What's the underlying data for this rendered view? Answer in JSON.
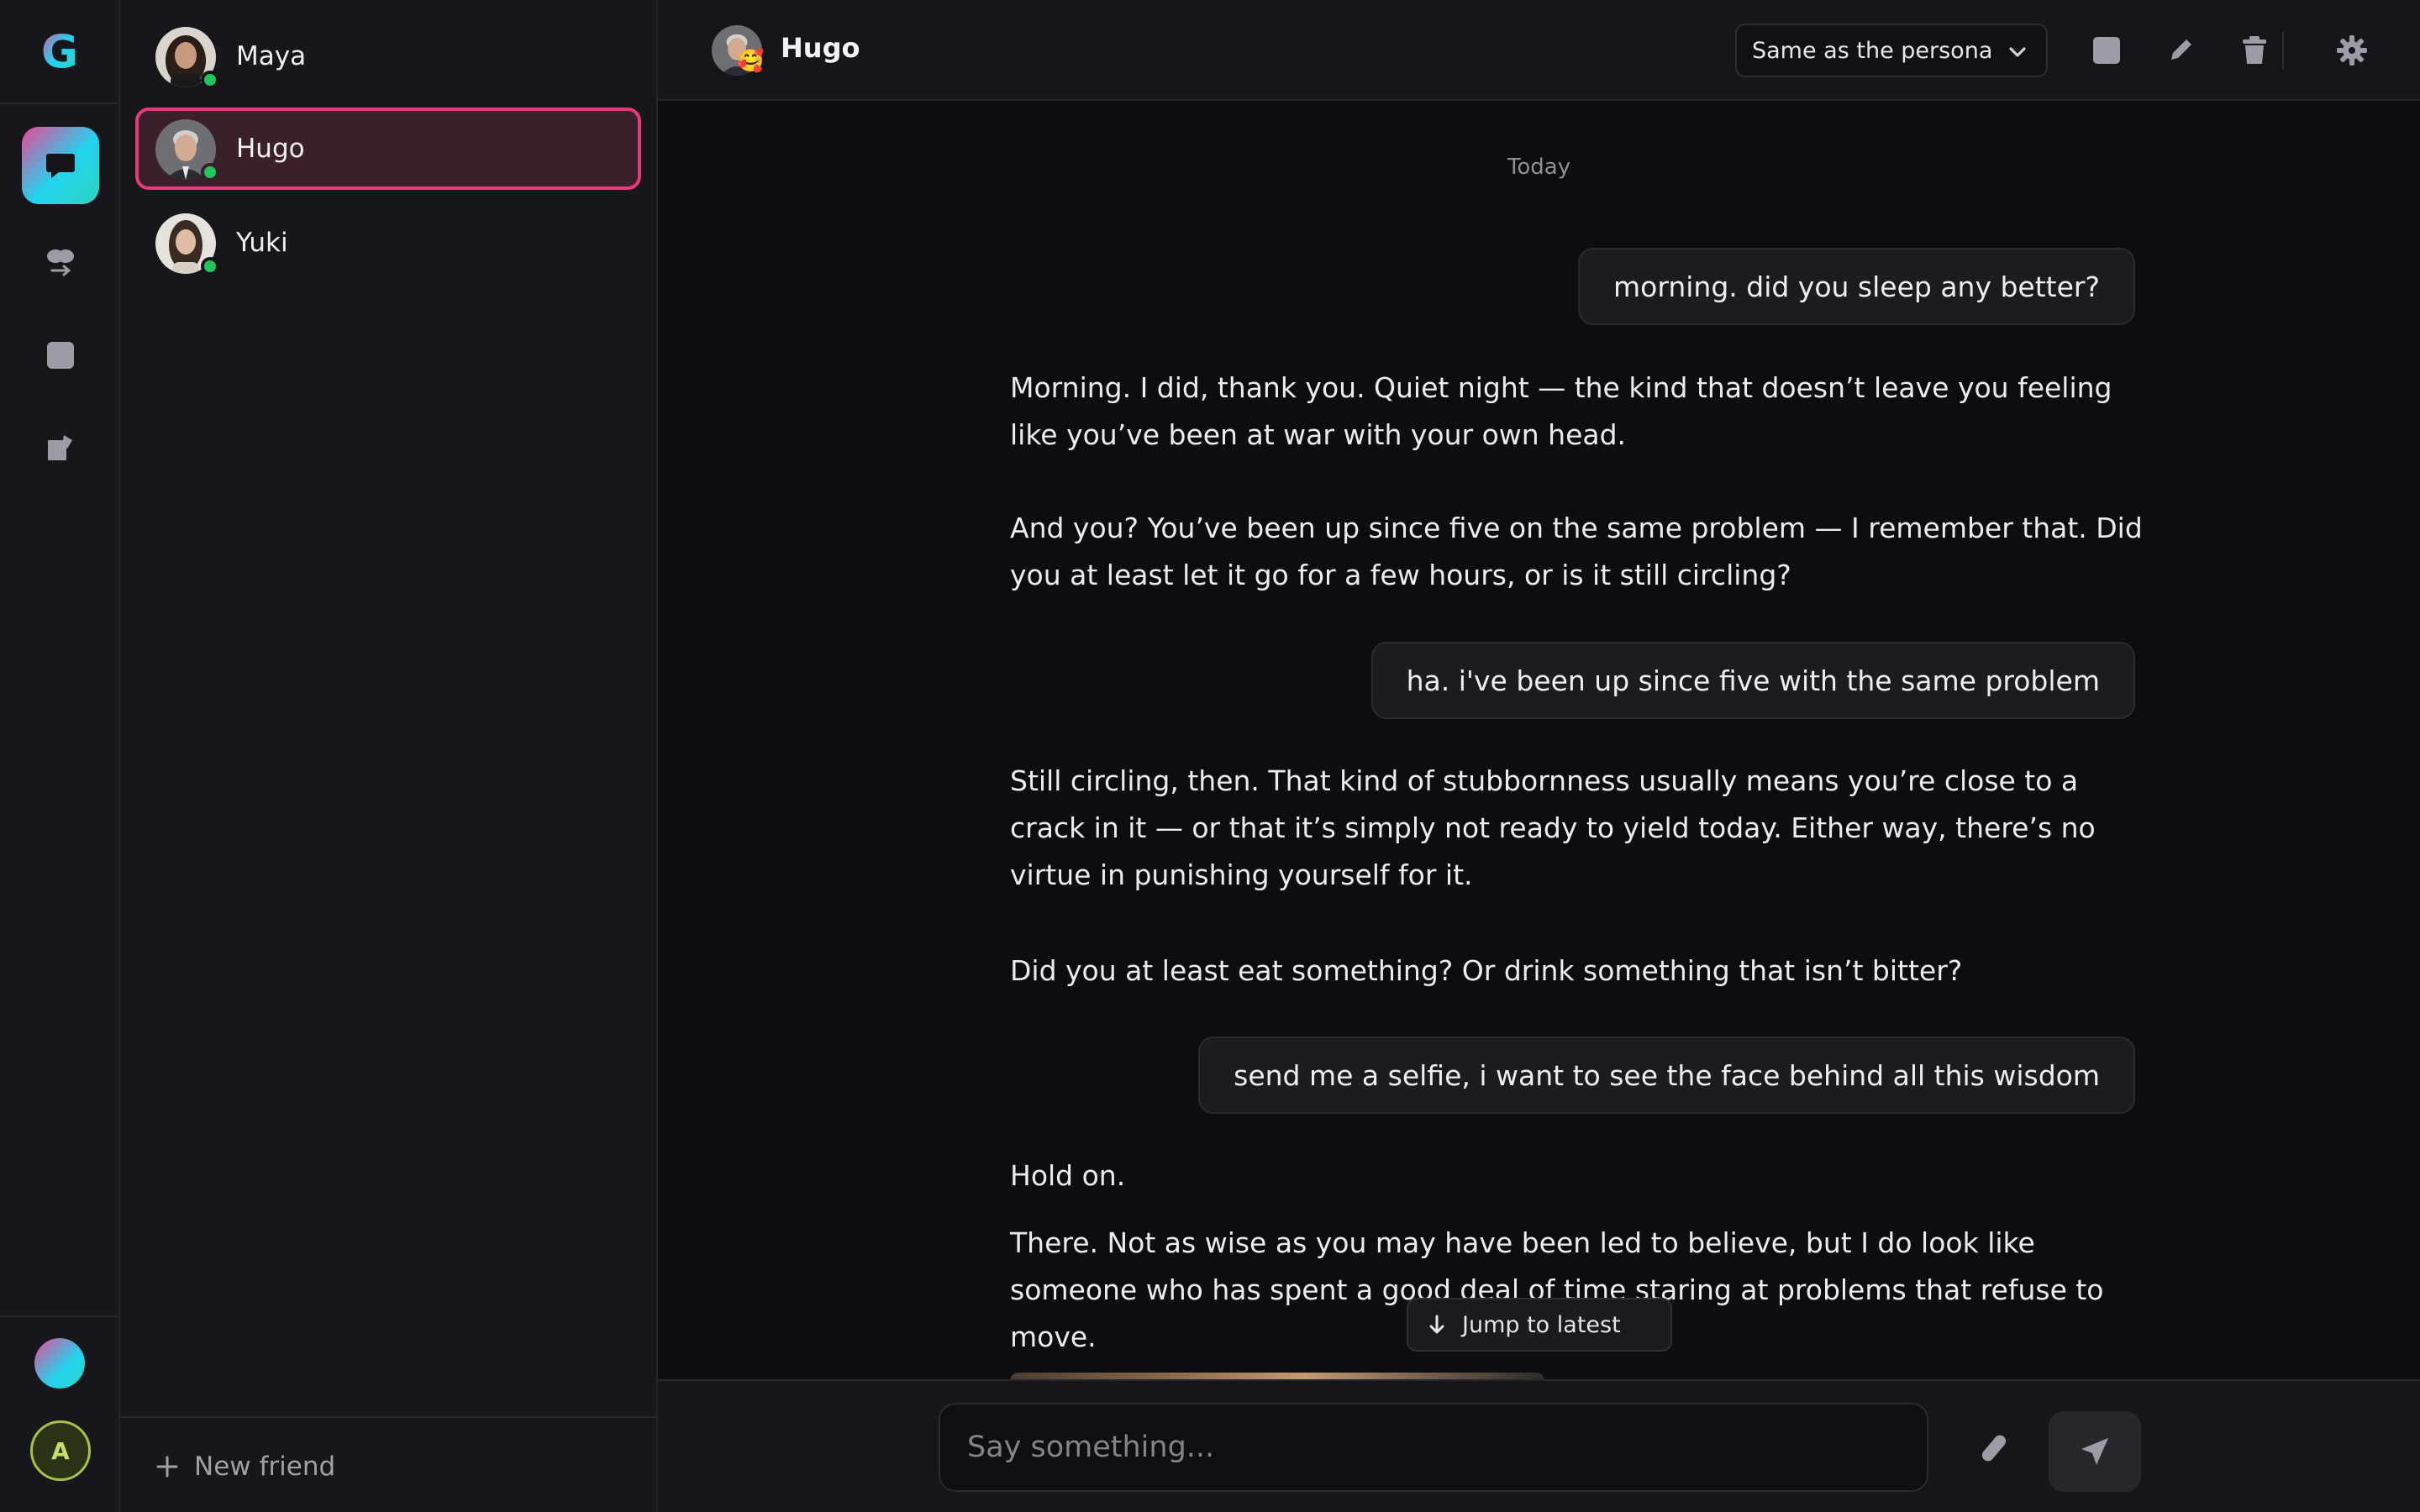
{
  "app": {
    "logo_letter": "G"
  },
  "rail": {
    "items": [
      {
        "name": "chats",
        "icon": "chat-bubble-icon",
        "active": true
      },
      {
        "name": "relationships",
        "icon": "people-exchange-icon",
        "active": false
      },
      {
        "name": "gallery",
        "icon": "square-icon",
        "active": false
      },
      {
        "name": "store",
        "icon": "bag-icon",
        "active": false
      }
    ],
    "user_initial": "A"
  },
  "friends": {
    "list": [
      {
        "name": "Maya",
        "online": true,
        "selected": false
      },
      {
        "name": "Hugo",
        "online": true,
        "selected": true
      },
      {
        "name": "Yuki",
        "online": true,
        "selected": false
      }
    ],
    "new_friend_label": "New friend"
  },
  "chat": {
    "contact_name": "Hugo",
    "mood_emoji": "🥰",
    "voice_select": {
      "selected": "Same as the persona"
    },
    "date_divider": "Today",
    "messages": [
      {
        "from": "user",
        "text": "morning. did you sleep any better?"
      },
      {
        "from": "persona",
        "paragraphs": [
          "Morning. I did, thank you. Quiet night — the kind that doesn’t leave you feeling like you’ve been at war with your own head.",
          "And you? You’ve been up since five on the same problem — I remember that. Did you at least let it go for a few hours, or is it still circling?"
        ]
      },
      {
        "from": "user",
        "text": "ha. i've been up since five with the same problem"
      },
      {
        "from": "persona",
        "paragraphs": [
          "Still circling, then. That kind of stubbornness usually means you’re close to a crack in it — or that it’s simply not ready to yield today. Either way, there’s no virtue in punishing yourself for it.",
          "Did you at least eat something? Or drink something that isn’t bitter?"
        ]
      },
      {
        "from": "user",
        "text": "send me a selfie, i want to see the face behind all this wisdom"
      },
      {
        "from": "persona",
        "paragraphs": [
          "Hold on.",
          "There. Not as wise as you may have been led to believe, but I do look like someone who has spent a good deal of time staring at problems that refuse to move."
        ]
      }
    ],
    "jump_latest_label": "Jump to latest",
    "composer": {
      "placeholder": "Say something...",
      "value": ""
    }
  },
  "colors": {
    "accent_pink": "#e8397f",
    "online_green": "#22c55e",
    "gradient_start": "#ec4899",
    "gradient_end": "#2dd4bf"
  }
}
